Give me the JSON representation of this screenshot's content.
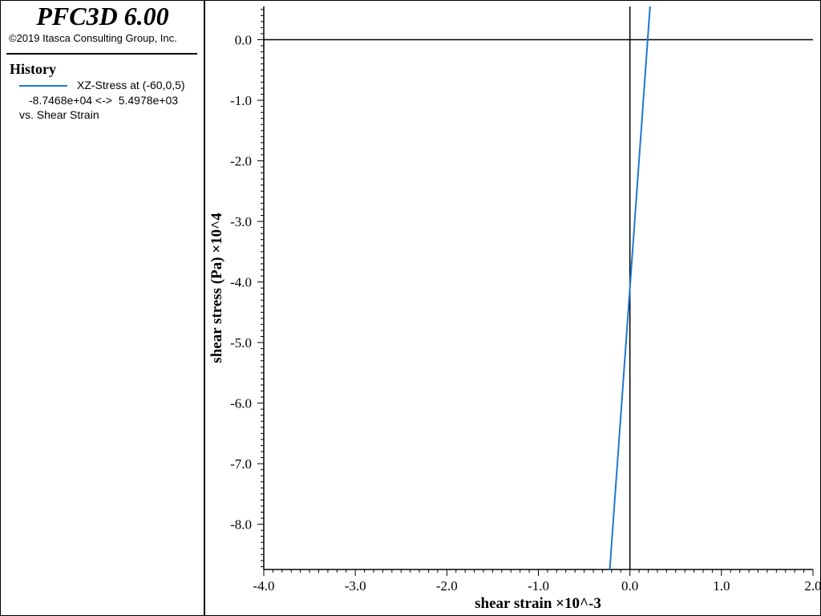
{
  "app": {
    "title": "PFC3D 6.00",
    "copyright": "©2019 Itasca Consulting Group, Inc."
  },
  "legend": {
    "heading": "History",
    "series_name": "XZ-Stress at (-60,0,5)",
    "range_text": "-8.7468e+04 <->  5.4978e+03",
    "vs_text": "vs. Shear Strain"
  },
  "colors": {
    "series": "#1f78d1",
    "axis": "#000000"
  },
  "chart_data": {
    "type": "line",
    "xlabel": "shear strain ×10^-3",
    "ylabel": "shear stress (Pa) ×10^4",
    "xlim": [
      -4.0,
      2.0
    ],
    "ylim": [
      -8.7468,
      0.5498
    ],
    "x_ticks": [
      "-4.0",
      "-3.0",
      "-2.0",
      "-1.0",
      "0.0",
      "1.0",
      "2.0"
    ],
    "y_ticks": [
      "0.0",
      "-1.0",
      "-2.0",
      "-3.0",
      "-4.0",
      "-5.0",
      "-6.0",
      "-7.0",
      "-8.0"
    ],
    "series": [
      {
        "name": "XZ-Stress at (-60,0,5)",
        "x": [
          -0.22,
          0.0,
          0.22
        ],
        "y": [
          -8.7468,
          -4.1,
          0.5498
        ]
      }
    ]
  }
}
